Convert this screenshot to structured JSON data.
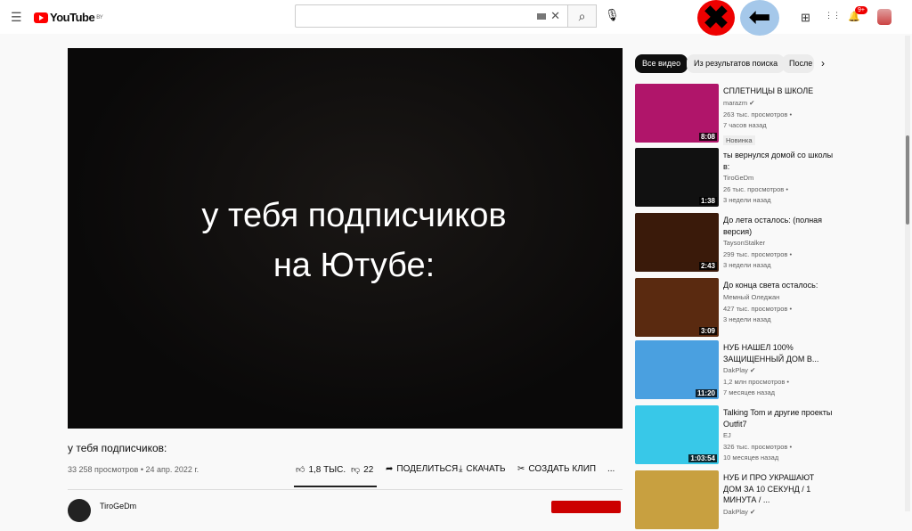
{
  "header": {
    "menu_icon": "☰",
    "logo": "YouTube",
    "region": "BY",
    "search_placeholder": "",
    "clear": "✕",
    "search_icon": "⌕",
    "mic_icon": "🎙",
    "close_overlay": "✖",
    "back_overlay": "⬅",
    "create_icon": "⊞",
    "apps_icon": "⋮⋮",
    "bell_icon": "🔔",
    "notif_badge": "9+"
  },
  "video": {
    "overlay_text": "у тебя подписчиков\nна Ютубе:",
    "title": "у тебя подписчиков:",
    "meta": "33 258 просмотров • 24 апр. 2022 г.",
    "actions": {
      "like": "1,8 ТЫС.",
      "dislike": "22",
      "share": "ПОДЕЛИТЬСЯ",
      "download": "СКАЧАТЬ",
      "clip": "СОЗДАТЬ КЛИП",
      "more": "..."
    },
    "channel": "TiroGeDm"
  },
  "sidebar": {
    "chips": [
      "Все видео",
      "Из результатов поиска",
      "После"
    ],
    "chip_next": "›",
    "items": [
      {
        "title": "СПЛЕТНИЦЫ В ШКОЛЕ",
        "channel": "marazm ✔",
        "views": "263 тыс. просмотров •",
        "age": "7 часов назад",
        "badge": "Новинка",
        "duration": "8:08",
        "color": "#b0156a"
      },
      {
        "title": "ты вернулся домой со школы в:",
        "channel": "TiroGeDm",
        "views": "26 тыс. просмотров •",
        "age": "3 недели назад",
        "duration": "1:38",
        "color": "#111"
      },
      {
        "title": "До лета осталось: (полная версия)",
        "channel": "TaysonStalker",
        "views": "299 тыс. просмотров •",
        "age": "3 недели назад",
        "duration": "2:43",
        "color": "#3a1a0a"
      },
      {
        "title": "До конца света осталось:",
        "channel": "Мемный Оледжан",
        "views": "427 тыс. просмотров •",
        "age": "3 недели назад",
        "duration": "3:09",
        "color": "#5a2a10"
      },
      {
        "title": "НУБ НАШЕЛ 100% ЗАЩИЩЕННЫЙ ДОМ В...",
        "channel": "DakPlay ✔",
        "views": "1,2 млн просмотров •",
        "age": "7 месяцев назад",
        "duration": "11:20",
        "color": "#4aa0e0"
      },
      {
        "title": "Talking Tom и другие проекты Outfit7",
        "channel": "EJ",
        "views": "326 тыс. просмотров •",
        "age": "10 месяцев назад",
        "duration": "1:03:54",
        "color": "#38c8e8"
      },
      {
        "title": "НУБ И ПРО УКРАШАЮТ ДОМ ЗА 10 СЕКУНД / 1 МИНУТА / ...",
        "channel": "DakPlay ✔",
        "views": "",
        "age": "",
        "duration": "",
        "color": "#c8a040"
      }
    ]
  }
}
